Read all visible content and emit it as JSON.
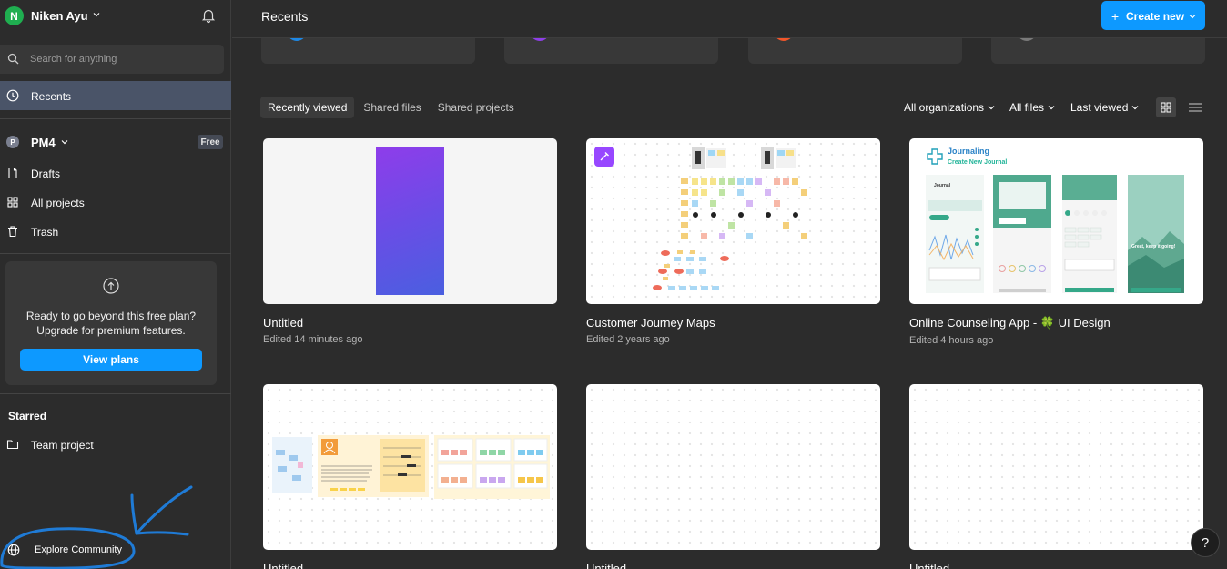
{
  "user": {
    "initial": "N",
    "name": "Niken Ayu"
  },
  "search": {
    "placeholder": "Search for anything"
  },
  "nav": {
    "recents": "Recents",
    "drafts": "Drafts",
    "all_projects": "All projects",
    "trash": "Trash"
  },
  "team": {
    "initial": "P",
    "name": "PM4",
    "badge": "Free"
  },
  "upgrade": {
    "line1": "Ready to go beyond this free plan?",
    "line2": "Upgrade for premium features.",
    "button": "View plans"
  },
  "starred": {
    "title": "Starred",
    "items": [
      "Team project"
    ]
  },
  "explore": {
    "label": "Explore Community"
  },
  "header": {
    "title": "Recents",
    "create": "Create new",
    "create_plus": "+"
  },
  "tabs": [
    "Recently viewed",
    "Shared files",
    "Shared projects"
  ],
  "filters": {
    "organizations": "All organizations",
    "files": "All files",
    "sort": "Last viewed"
  },
  "files": [
    {
      "title": "Untitled",
      "meta": "Edited 14 minutes ago"
    },
    {
      "title": "Customer Journey Maps",
      "meta": "Edited 2 years ago"
    },
    {
      "title": "Online Counseling App - ",
      "title_emoji": "🍀",
      "title_suffix": " UI Design",
      "meta": "Edited 4 hours ago"
    },
    {
      "title": "Untitled",
      "meta": ""
    },
    {
      "title": "Untitled",
      "meta": ""
    },
    {
      "title": "Untitled",
      "meta": ""
    }
  ],
  "journal": {
    "app_title": "Journaling",
    "subtitle": "Create New Journal",
    "screen1": "Journal",
    "screen4": "Great, keep it going!"
  },
  "help": "?",
  "colors": {
    "accent": "#0d99ff",
    "selected_nav": "#4a5468",
    "annotation": "#1f7bd6"
  }
}
